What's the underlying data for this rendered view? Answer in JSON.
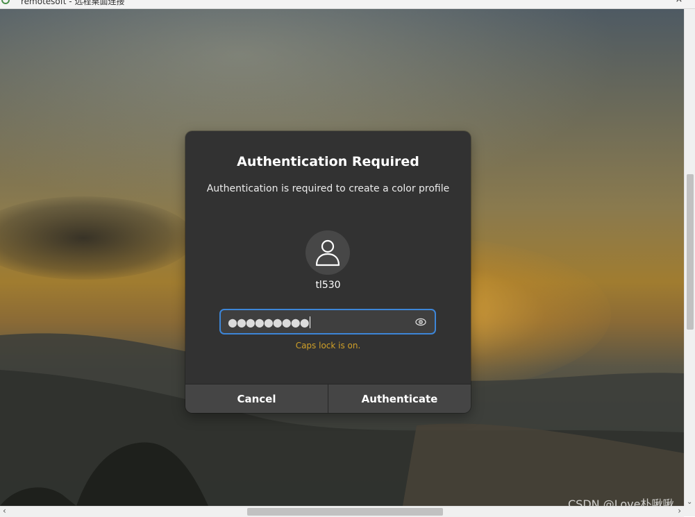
{
  "window": {
    "title": "remotesoft - 远程桌面连接",
    "minimize_label": "–",
    "close_label": "×"
  },
  "dialog": {
    "title": "Authentication Required",
    "message": "Authentication is required to create a color profile",
    "username": "tl530",
    "password_mask": "●●●●●●●●●",
    "caps_lock_warning": "Caps lock is on.",
    "cancel_label": "Cancel",
    "authenticate_label": "Authenticate"
  },
  "watermark": "CSDN @Love朴啾啾",
  "scrollbar": {
    "left_arrow": "‹",
    "right_arrow": "›",
    "down_arrow": "⌄"
  },
  "colors": {
    "accent": "#3d86d8",
    "warning": "#d0a028",
    "dialog_bg": "#323232"
  }
}
